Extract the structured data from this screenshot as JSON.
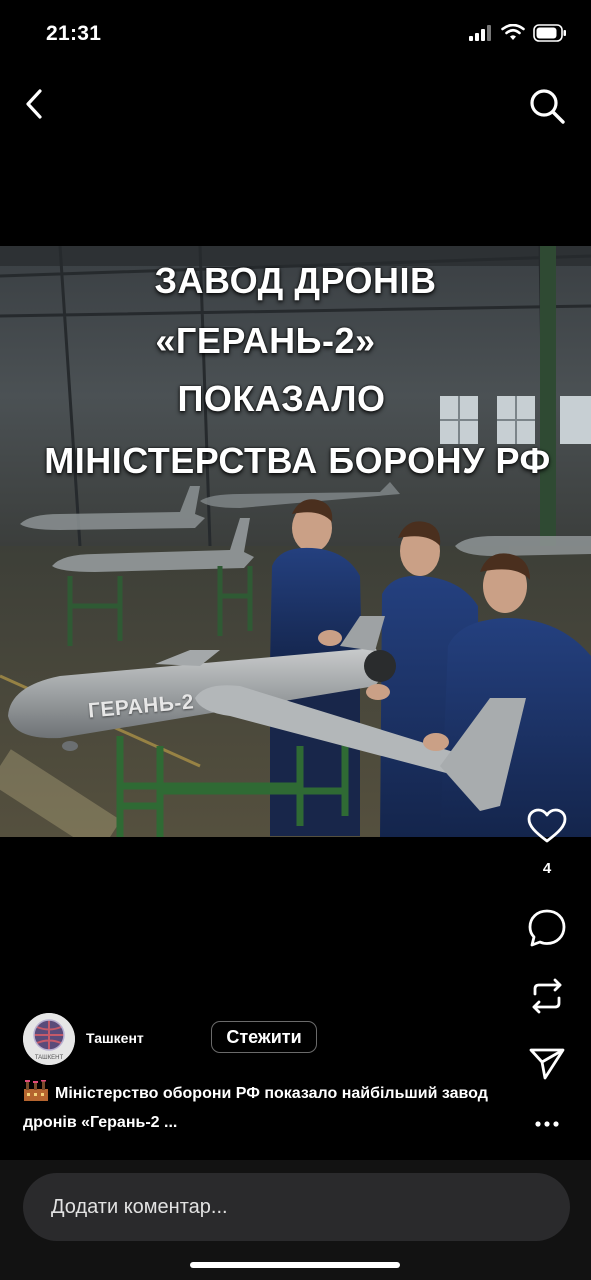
{
  "status_bar": {
    "time": "21:31",
    "icons": [
      "cellular-signal-icon",
      "wifi-icon",
      "battery-icon"
    ]
  },
  "nav": {
    "back_icon": "chevron-left-icon",
    "search_icon": "search-icon"
  },
  "media": {
    "overlay_lines": [
      "ЗАВОД ДРОНІВ",
      "«ГЕРАНЬ-2»",
      "ПОКАЗАЛО",
      "МІНІСТЕРСТВА БОРОНУ РФ"
    ],
    "drone_label": "ГЕРАНЬ-2"
  },
  "actions": {
    "like_icon": "heart-icon",
    "like_count": "4",
    "comment_icon": "comment-bubble-icon",
    "repost_icon": "repost-icon",
    "share_icon": "send-icon",
    "more_icon": "more-dots-icon"
  },
  "author": {
    "name": "Ташкент",
    "avatar_text": "TAШКЕНТ",
    "follow_label": "Стежити"
  },
  "caption": {
    "emoji": "factory-emoji",
    "text": "Міністерство оборони РФ показало найбільший завод дронів «Герань-2 ..."
  },
  "comment": {
    "placeholder": "Додати коментар..."
  },
  "colors": {
    "background": "#000000",
    "input_bg": "#2a2a2c",
    "text": "#ffffff"
  }
}
